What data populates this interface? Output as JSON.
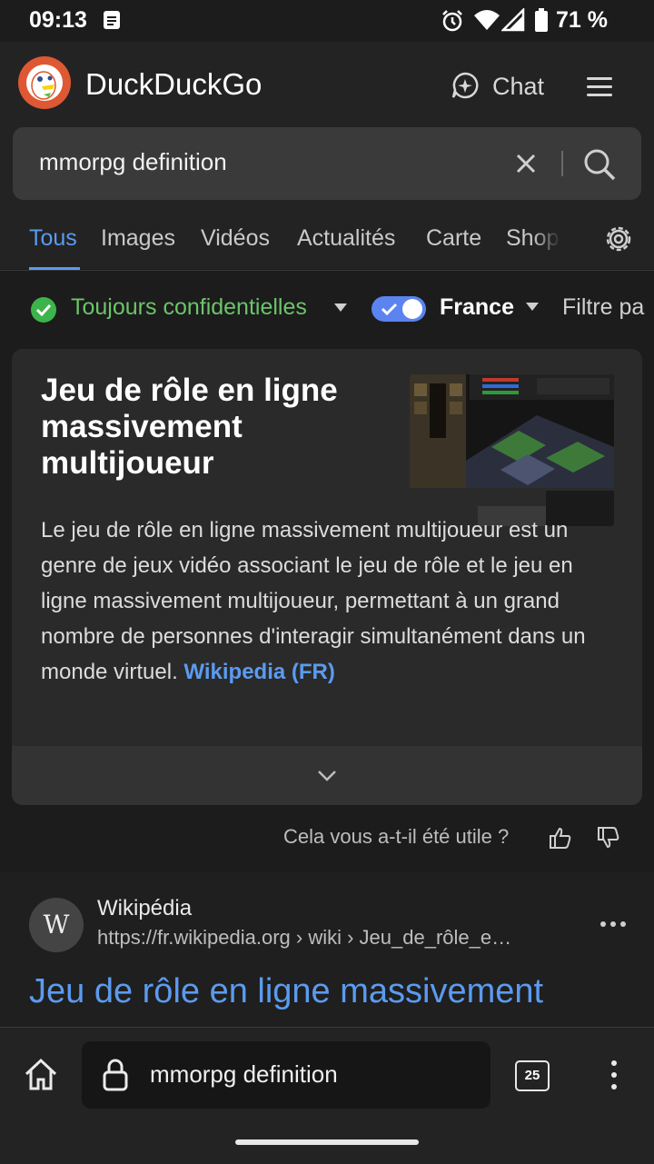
{
  "status_bar": {
    "time": "09:13",
    "battery": "71 %"
  },
  "header": {
    "brand": "DuckDuckGo",
    "chat_label": "Chat"
  },
  "search": {
    "query": "mmorpg definition"
  },
  "tabs": [
    "Tous",
    "Images",
    "Vidéos",
    "Actualités",
    "Carte",
    "Shop"
  ],
  "filters": {
    "privacy": "Toujours confidentielles",
    "region": "France",
    "date_filter": "Filtre pa"
  },
  "knowledge_card": {
    "title": "Jeu de rôle en ligne massivement multijoueur",
    "text": "Le jeu de rôle en ligne massivement multijoueur est un genre de jeux vidéo associant le jeu de rôle et le jeu en ligne massivement multijoueur, permettant à un grand nombre de personnes d'interagir simultanément dans un monde virtuel.",
    "source_link": "Wikipedia (FR)",
    "image_icon": "game-screenshot-image"
  },
  "feedback": {
    "question": "Cela vous a-t-il été utile ?"
  },
  "result": {
    "site_name": "Wikipédia",
    "favicon_letter": "W",
    "url": "https://fr.wikipedia.org › wiki › Jeu_de_rôle_e…",
    "title": "Jeu de rôle en ligne massivement"
  },
  "bottom_bar": {
    "url": "mmorpg definition",
    "tab_count": "25"
  },
  "colors": {
    "accent": "#5b9bf0",
    "brand_orange": "#de5833",
    "check_green": "#3cb44b"
  }
}
